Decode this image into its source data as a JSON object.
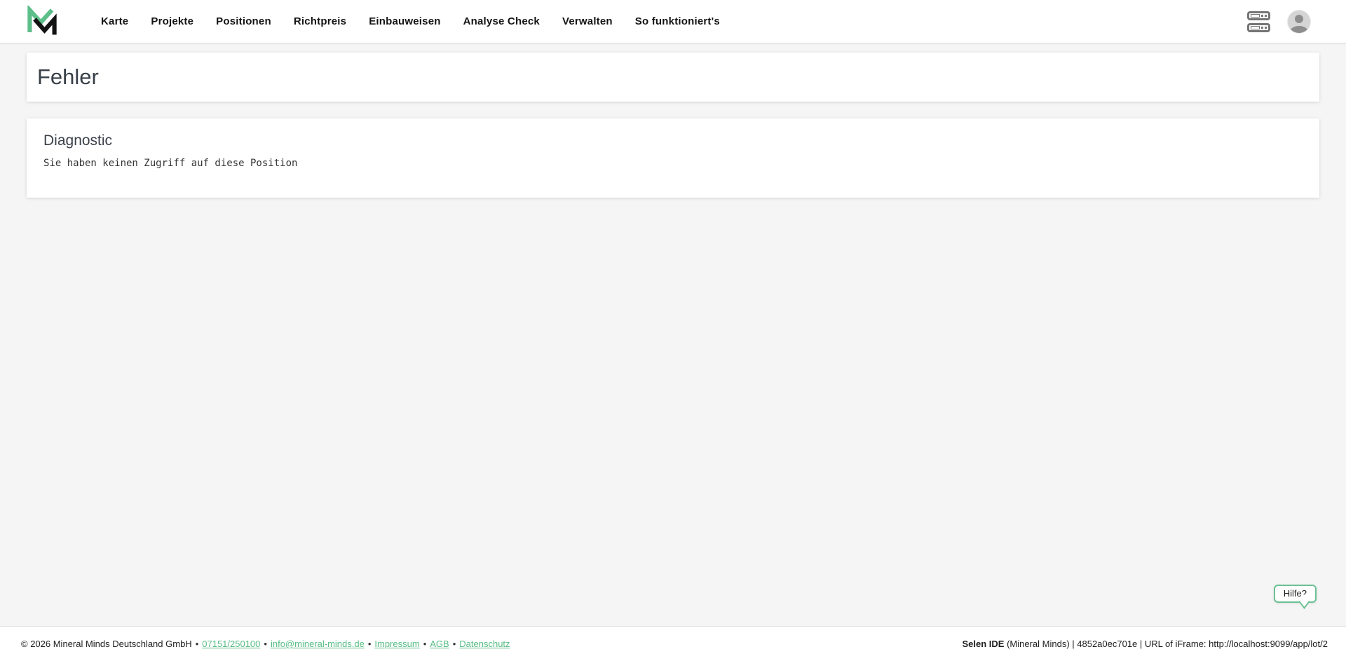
{
  "colors": {
    "brand_green": "#57bd84",
    "logo_green": "#5dbe8a",
    "page_background": "#f5f5f5",
    "icon_gray": "#757575"
  },
  "nav": {
    "items": [
      {
        "label": "Karte"
      },
      {
        "label": "Projekte"
      },
      {
        "label": "Positionen"
      },
      {
        "label": "Richtpreis"
      },
      {
        "label": "Einbauweisen"
      },
      {
        "label": "Analyse Check"
      },
      {
        "label": "Verwalten"
      },
      {
        "label": "So funktioniert's"
      }
    ]
  },
  "page": {
    "title": "Fehler"
  },
  "diagnostic": {
    "title": "Diagnostic",
    "message": "Sie haben keinen Zugriff auf diese Position"
  },
  "help": {
    "label": "Hilfe?"
  },
  "footer": {
    "separator": "•",
    "copyright": "© 2026 Mineral Minds Deutschland GmbH",
    "phone": "07151/250100",
    "email": "info@mineral-minds.de",
    "impressum": "Impressum",
    "agb": "AGB",
    "datenschutz": "Datenschutz",
    "ide_name": "Selen IDE",
    "ide_info": "(Mineral Minds) | 4852a0ec701e | URL of iFrame: http://localhost:9099/app/lot/2"
  }
}
